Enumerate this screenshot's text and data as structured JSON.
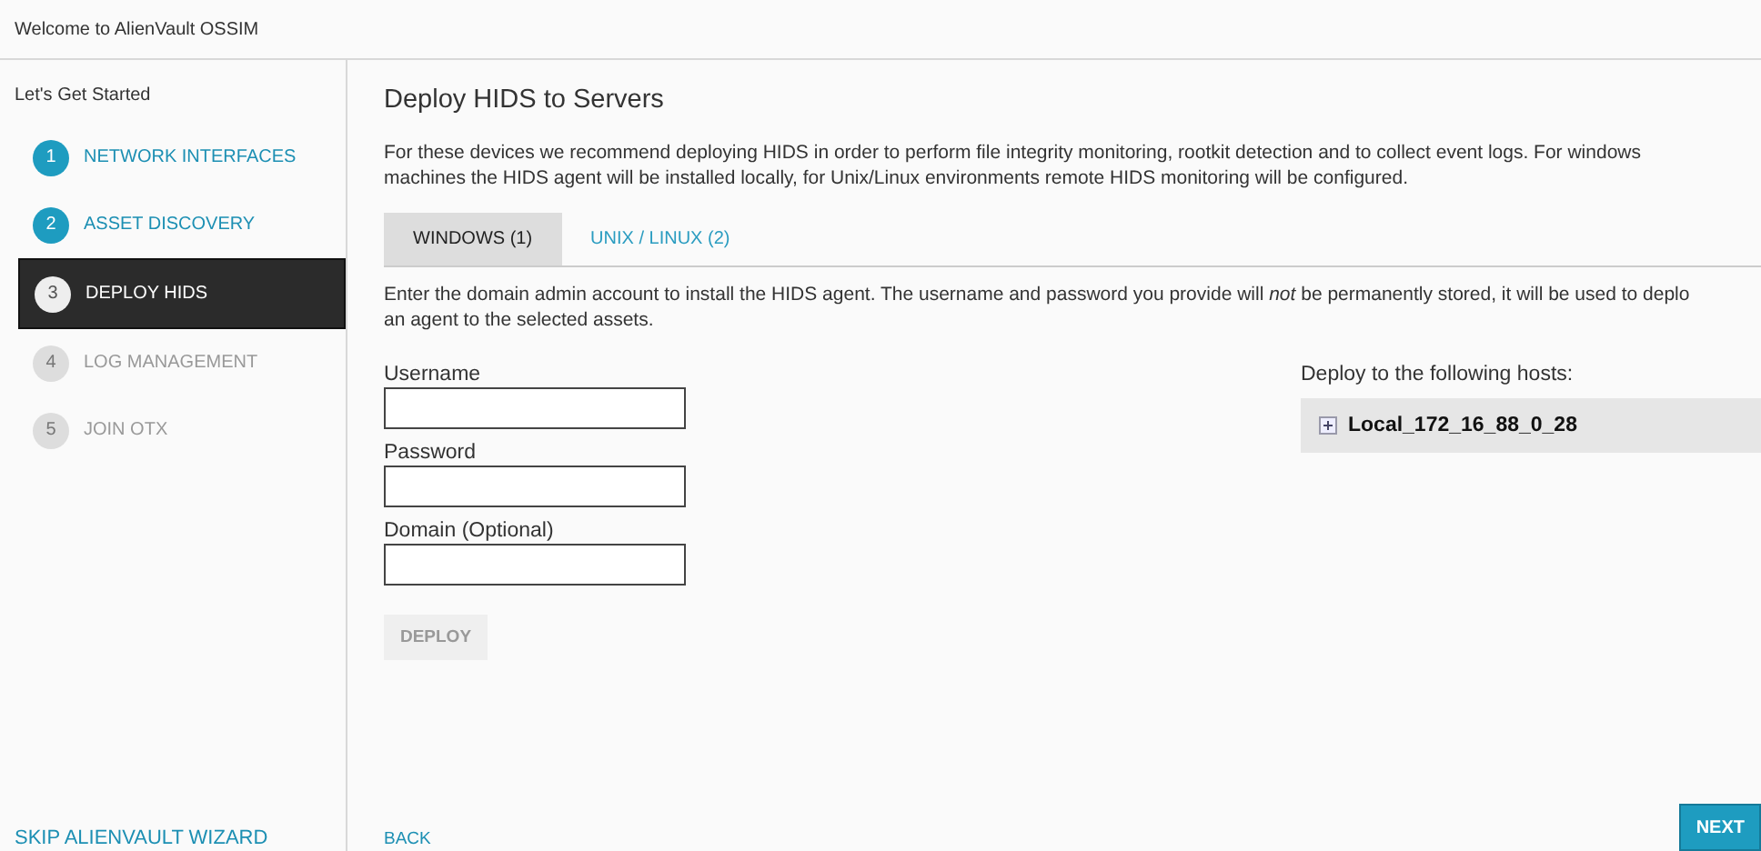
{
  "header": {
    "title": "Welcome to AlienVault OSSIM"
  },
  "sidebar": {
    "heading": "Let's Get Started",
    "steps": [
      {
        "number": "1",
        "label": "NETWORK INTERFACES",
        "completed": true,
        "selected": false
      },
      {
        "number": "2",
        "label": "ASSET DISCOVERY",
        "completed": true,
        "selected": false
      },
      {
        "number": "3",
        "label": "DEPLOY HIDS",
        "completed": false,
        "selected": true
      },
      {
        "number": "4",
        "label": "LOG MANAGEMENT",
        "completed": false,
        "selected": false
      },
      {
        "number": "5",
        "label": "JOIN OTX",
        "completed": false,
        "selected": false
      }
    ],
    "skip_link": "SKIP ALIENVAULT WIZARD"
  },
  "main": {
    "title": "Deploy HIDS to Servers",
    "intro": "For these devices we recommend deploying HIDS in order to perform file integrity monitoring, rootkit detection and to collect event logs. For windows\nmachines the HIDS agent will be installed locally, for Unix/Linux environments remote HIDS monitoring will be configured.",
    "tabs": [
      {
        "label": "WINDOWS (1)",
        "selected": true
      },
      {
        "label": "UNIX / LINUX (2)",
        "selected": false
      }
    ],
    "instructions": "Enter the domain admin account to install the HIDS agent. The username and password you provide will *not* be permanently stored, it will be used to deplo\nan agent to the selected assets.",
    "fields": [
      {
        "label": "Username"
      },
      {
        "label": "Password"
      },
      {
        "label": "Domain (Optional)"
      }
    ],
    "deploy_button": {
      "label": "DEPLOY",
      "disabled": true
    },
    "hosts": {
      "heading": "Deploy to the following hosts:",
      "items": [
        {
          "label": "Local_172_16_88_0_28",
          "expanded": false
        }
      ]
    },
    "back": "BACK",
    "next": "NEXT"
  }
}
